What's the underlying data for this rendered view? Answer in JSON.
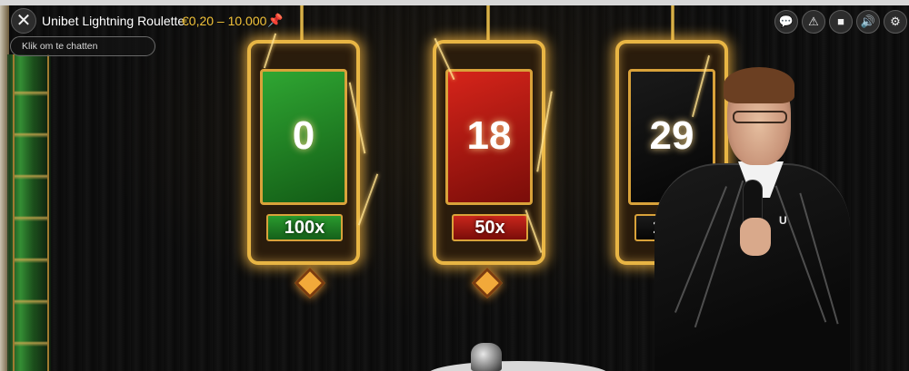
{
  "header": {
    "close_symbol": "✕",
    "title": "Unibet Lightning Roulette",
    "limits": "€0,20 – 10.000",
    "pin_symbol": "📌"
  },
  "chat": {
    "placeholder": "Klik om te chatten"
  },
  "hud_buttons": [
    {
      "name": "chat-icon",
      "symbol": "💬"
    },
    {
      "name": "alert-icon",
      "symbol": "⚠"
    },
    {
      "name": "camera-icon",
      "symbol": "■"
    },
    {
      "name": "sound-icon",
      "symbol": "🔊"
    },
    {
      "name": "settings-icon",
      "symbol": "⚙"
    }
  ],
  "lightning_numbers": [
    {
      "number": "0",
      "multiplier": "100x",
      "color": "#1f8a26"
    },
    {
      "number": "18",
      "multiplier": "50x",
      "color": "#b3140f"
    },
    {
      "number": "29",
      "multiplier": "100x",
      "color": "#111111"
    }
  ],
  "colors": {
    "accent_gold": "#f2c33a",
    "frame_gold": "#e8b544"
  }
}
